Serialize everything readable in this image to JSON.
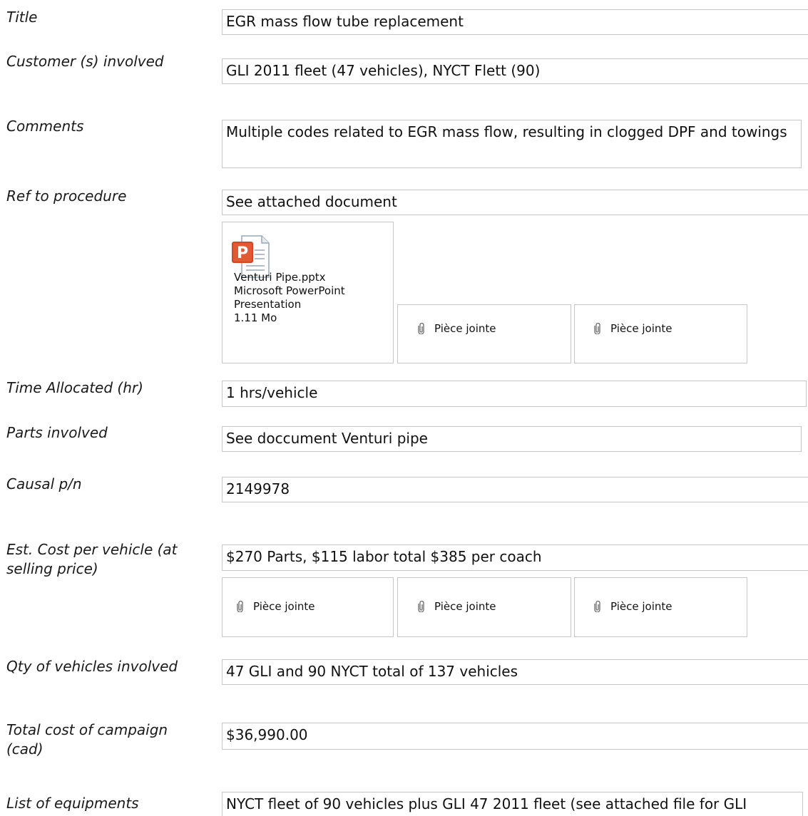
{
  "form": {
    "title": {
      "label": "Title",
      "value": "EGR mass flow tube replacement"
    },
    "customers": {
      "label": "Customer (s) involved",
      "value": "GLI 2011 fleet (47 vehicles), NYCT Flett (90)"
    },
    "comments": {
      "label": "Comments",
      "value": "Multiple codes related to EGR mass flow, resulting in clogged DPF and towings"
    },
    "ref_procedure": {
      "label": "Ref to procedure",
      "value": "See attached document",
      "file": {
        "icon": "powerpoint-file-icon",
        "name": "Venturi Pipe.pptx",
        "type": "Microsoft PowerPoint Presentation",
        "size": "1.11 Mo"
      },
      "attachments": [
        "Pièce jointe",
        "Pièce jointe"
      ]
    },
    "time_allocated": {
      "label": "Time Allocated (hr)",
      "value": "1 hrs/vehicle"
    },
    "parts_involved": {
      "label": "Parts involved",
      "value": "See doccument Venturi pipe"
    },
    "causal_pn": {
      "label": "Causal p/n",
      "value": "2149978"
    },
    "est_cost": {
      "label": "Est. Cost per vehicle (at selling price)",
      "value": "$270 Parts, $115 labor total $385 per coach",
      "attachments": [
        "Pièce jointe",
        "Pièce jointe",
        "Pièce jointe"
      ]
    },
    "qty_vehicles": {
      "label": "Qty of vehicles involved",
      "value": "47 GLI and 90 NYCT total of 137 vehicles"
    },
    "total_cost": {
      "label": "Total cost of campaign (cad)",
      "value": "$36,990.00"
    },
    "equipments": {
      "label": "List of equipments",
      "value": "NYCT fleet of 90 vehicles plus GLI 47 2011 fleet (see attached file for GLI"
    }
  },
  "colors": {
    "border": "#c6c6c6",
    "ppt_orange": "#d24726",
    "clip": "#6a6a6a"
  },
  "icons": {
    "attachment": "paperclip-icon"
  }
}
